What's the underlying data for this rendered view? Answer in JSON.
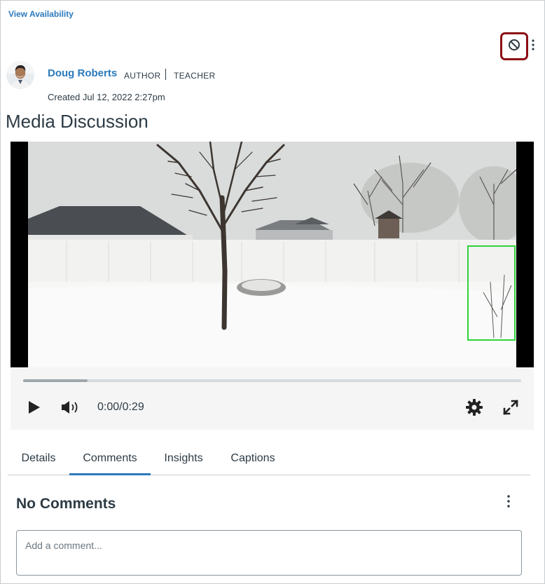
{
  "header": {
    "view_availability": "View Availability"
  },
  "post": {
    "author_name": "Doug Roberts",
    "role_author": "AUTHOR",
    "role_teacher": "TEACHER",
    "created": "Created Jul 12, 2022 2:27pm",
    "title": "Media Discussion"
  },
  "player": {
    "time": "0:00/0:29",
    "buffered_fraction": 0.13
  },
  "tabs": [
    {
      "label": "Details"
    },
    {
      "label": "Comments",
      "selected": true
    },
    {
      "label": "Insights"
    },
    {
      "label": "Captions"
    }
  ],
  "comments": {
    "heading": "No Comments",
    "placeholder": "Add a comment..."
  },
  "icons": {
    "unpublish": "unpublish-icon",
    "more": "kebab-icon",
    "play": "play-icon",
    "volume": "volume-icon",
    "settings": "gear-icon",
    "fullscreen": "fullscreen-icon"
  },
  "colors": {
    "link": "#2b7abc",
    "highlight_border": "#8b0f14",
    "text": "#2d3b45",
    "tab_underline": "#2b7abc"
  }
}
